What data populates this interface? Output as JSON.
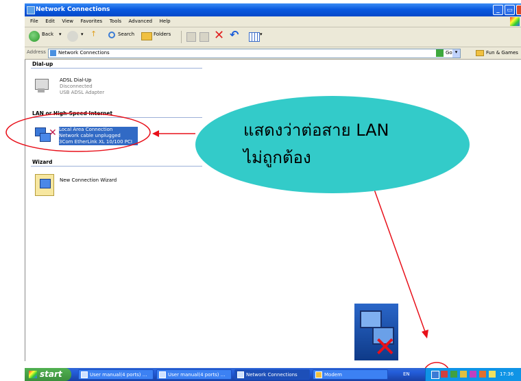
{
  "window": {
    "title": "Network Connections"
  },
  "menu": [
    "File",
    "Edit",
    "View",
    "Favorites",
    "Tools",
    "Advanced",
    "Help"
  ],
  "toolbar": {
    "back": "Back",
    "search": "Search",
    "folders": "Folders"
  },
  "address": {
    "label": "Address",
    "value": "Network Connections",
    "go": "Go",
    "link": "Fun & Games"
  },
  "sections": {
    "dialup": {
      "header": "Dial-up",
      "item": {
        "name": "ADSL Dial-Up",
        "status": "Disconnected",
        "device": "USB ADSL Adapter"
      }
    },
    "lan": {
      "header": "LAN or High-Speed Internet",
      "item": {
        "name": "Local Area Connection",
        "status": "Network cable unplugged",
        "device": "3Com EtherLink XL 10/100 PCI"
      }
    },
    "wizard": {
      "header": "Wizard",
      "item": {
        "name": "New Connection Wizard"
      }
    }
  },
  "callout": {
    "line1": "แสดงว่าต่อสาย LAN",
    "line2": "ไม่ถูกต้อง"
  },
  "taskbar": {
    "start": "start",
    "buttons": [
      "User manual(4 ports) ...",
      "User manual(4 ports) ...",
      "Network Connections",
      "Modem"
    ],
    "lang": "EN",
    "clock": "17:36"
  },
  "colors": {
    "callout": "#33cbc9",
    "annotation": "#e8101a",
    "selection": "#316ac5"
  }
}
